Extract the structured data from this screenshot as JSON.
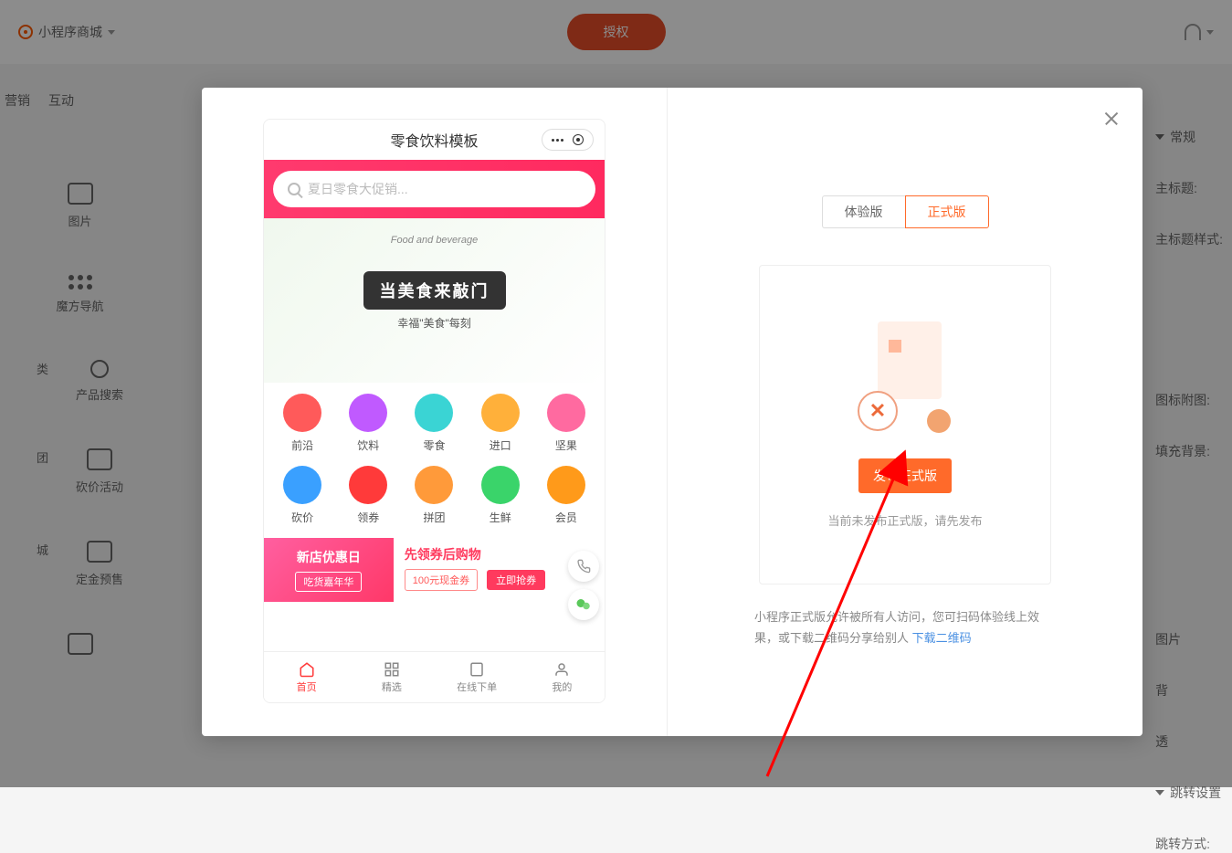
{
  "topbar": {
    "store_label": "小程序商城",
    "auth_button": "授权"
  },
  "left_tabs": [
    "营销",
    "互动"
  ],
  "sidebar": {
    "items": [
      {
        "label": "图片"
      },
      {
        "label": "魔方导航"
      },
      {
        "label": "类"
      },
      {
        "label": "产品搜索"
      },
      {
        "label": "团"
      },
      {
        "label": "砍价活动"
      },
      {
        "label": "城"
      },
      {
        "label": "定金预售"
      }
    ]
  },
  "right_panel": {
    "section1": "常规",
    "items1": [
      "主标题:",
      "主标题样式:",
      "图标附图:",
      "填充背景:",
      "图片",
      "背",
      "透"
    ],
    "section2": "跳转设置",
    "items2": [
      "跳转方式:"
    ]
  },
  "modal": {
    "phone": {
      "title": "零食饮料模板",
      "search_placeholder": "夏日零食大促销...",
      "banner_script": "Food and beverage",
      "banner_main": "当美食来敲门",
      "banner_sub": "幸福\"美食\"每刻",
      "categories_row1": [
        {
          "label": "前沿",
          "color": "#ff5a5a"
        },
        {
          "label": "饮料",
          "color": "#c05aff"
        },
        {
          "label": "零食",
          "color": "#3ad4d4"
        },
        {
          "label": "进口",
          "color": "#ffb03a"
        },
        {
          "label": "坚果",
          "color": "#ff6aa0"
        }
      ],
      "categories_row2": [
        {
          "label": "砍价",
          "color": "#3aa0ff"
        },
        {
          "label": "领券",
          "color": "#ff3a3a"
        },
        {
          "label": "拼团",
          "color": "#ff9a3a"
        },
        {
          "label": "生鲜",
          "color": "#3ad46a"
        },
        {
          "label": "会员",
          "color": "#ff9a1a"
        }
      ],
      "promo": {
        "left_title": "新店优惠日",
        "left_btn": "吃货嘉年华",
        "right_title": "先领券后购物",
        "coupon": "100元现金券",
        "grab": "立即抢券"
      },
      "tabs": [
        {
          "label": "首页",
          "active": true
        },
        {
          "label": "精选",
          "active": false
        },
        {
          "label": "在线下单",
          "active": false
        },
        {
          "label": "我的",
          "active": false
        }
      ]
    },
    "right": {
      "tab_trial": "体验版",
      "tab_official": "正式版",
      "publish_btn": "发布正式版",
      "status_text": "当前未发布正式版，请先发布",
      "info_text": "小程序正式版允许被所有人访问，您可扫码体验线上效果，或下载二维码分享给别人 ",
      "download_link": "下载二维码"
    }
  }
}
